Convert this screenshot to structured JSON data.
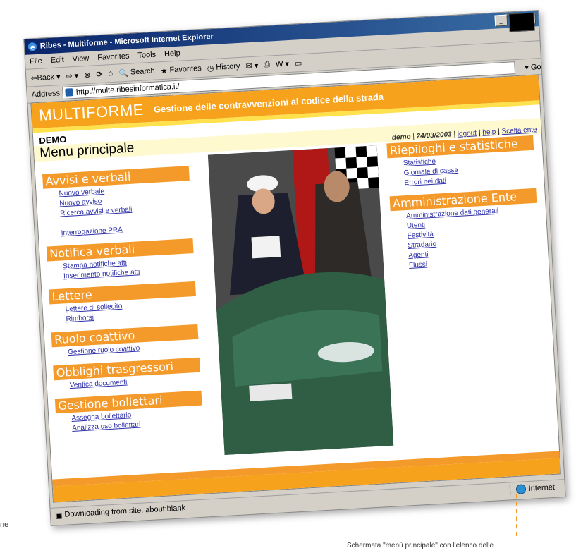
{
  "browser": {
    "title": "Ribes - Multiforme - Microsoft Internet Explorer",
    "window_buttons": [
      "_",
      "□",
      "×"
    ],
    "menu": [
      "File",
      "Edit",
      "View",
      "Favorites",
      "Tools",
      "Help"
    ],
    "toolbar": {
      "back": "⇦Back",
      "forward": "⇨",
      "search": "Search",
      "favorites": "Favorites",
      "history": "History",
      "go": "Go"
    },
    "address_label": "Address",
    "address_value": "http://multe.ribesinformatica.it/",
    "status_text": "Downloading from site: about:blank",
    "zone": "Internet"
  },
  "page": {
    "brand": "MULTIFORME",
    "subtitle": "Gestione delle contravvenzioni al codice della strada",
    "demo": "DEMO",
    "menu_title": "Menu principale",
    "user": "demo",
    "date": "24/03/2003",
    "links_top": [
      "logout",
      "help",
      "Scelta ente"
    ]
  },
  "left_sections": [
    {
      "title": "Avvisi e verbali",
      "links": [
        "Nuovo verbale",
        "Nuovo avviso",
        "Ricerca avvisi e verbali",
        "",
        "Interrogazione PRA"
      ]
    },
    {
      "title": "Notifica verbali",
      "links": [
        "Stampa notifiche atti",
        "Inserimento notifiche atti"
      ]
    },
    {
      "title": "Lettere",
      "links": [
        "Lettere di sollecito",
        "Rimborsi"
      ]
    },
    {
      "title": "Ruolo coattivo",
      "links": [
        "Gestione ruolo coattivo"
      ]
    },
    {
      "title": "Obblighi trasgressori",
      "links": [
        "Verifica documenti"
      ]
    },
    {
      "title": "Gestione bollettari",
      "links": [
        "Assegna bollettario",
        "Analizza uso bollettari"
      ]
    }
  ],
  "right_sections": [
    {
      "title": "Riepiloghi e statistiche",
      "links": [
        "Statistiche",
        "Giornale di cassa",
        "Errori nei dati"
      ]
    },
    {
      "title": "Amministrazione Ente",
      "links": [
        "Amministrazione dati generali",
        "Utenti",
        "Festività",
        "Stradario",
        "Agenti",
        "Flussi"
      ]
    }
  ],
  "caption": "Schermata \"menù principale\" con l'elenco delle",
  "left_crop_text": "ne",
  "colors": {
    "orange": "#f39a2b",
    "yellow": "#ffe14d",
    "link": "#2d2fa8"
  }
}
